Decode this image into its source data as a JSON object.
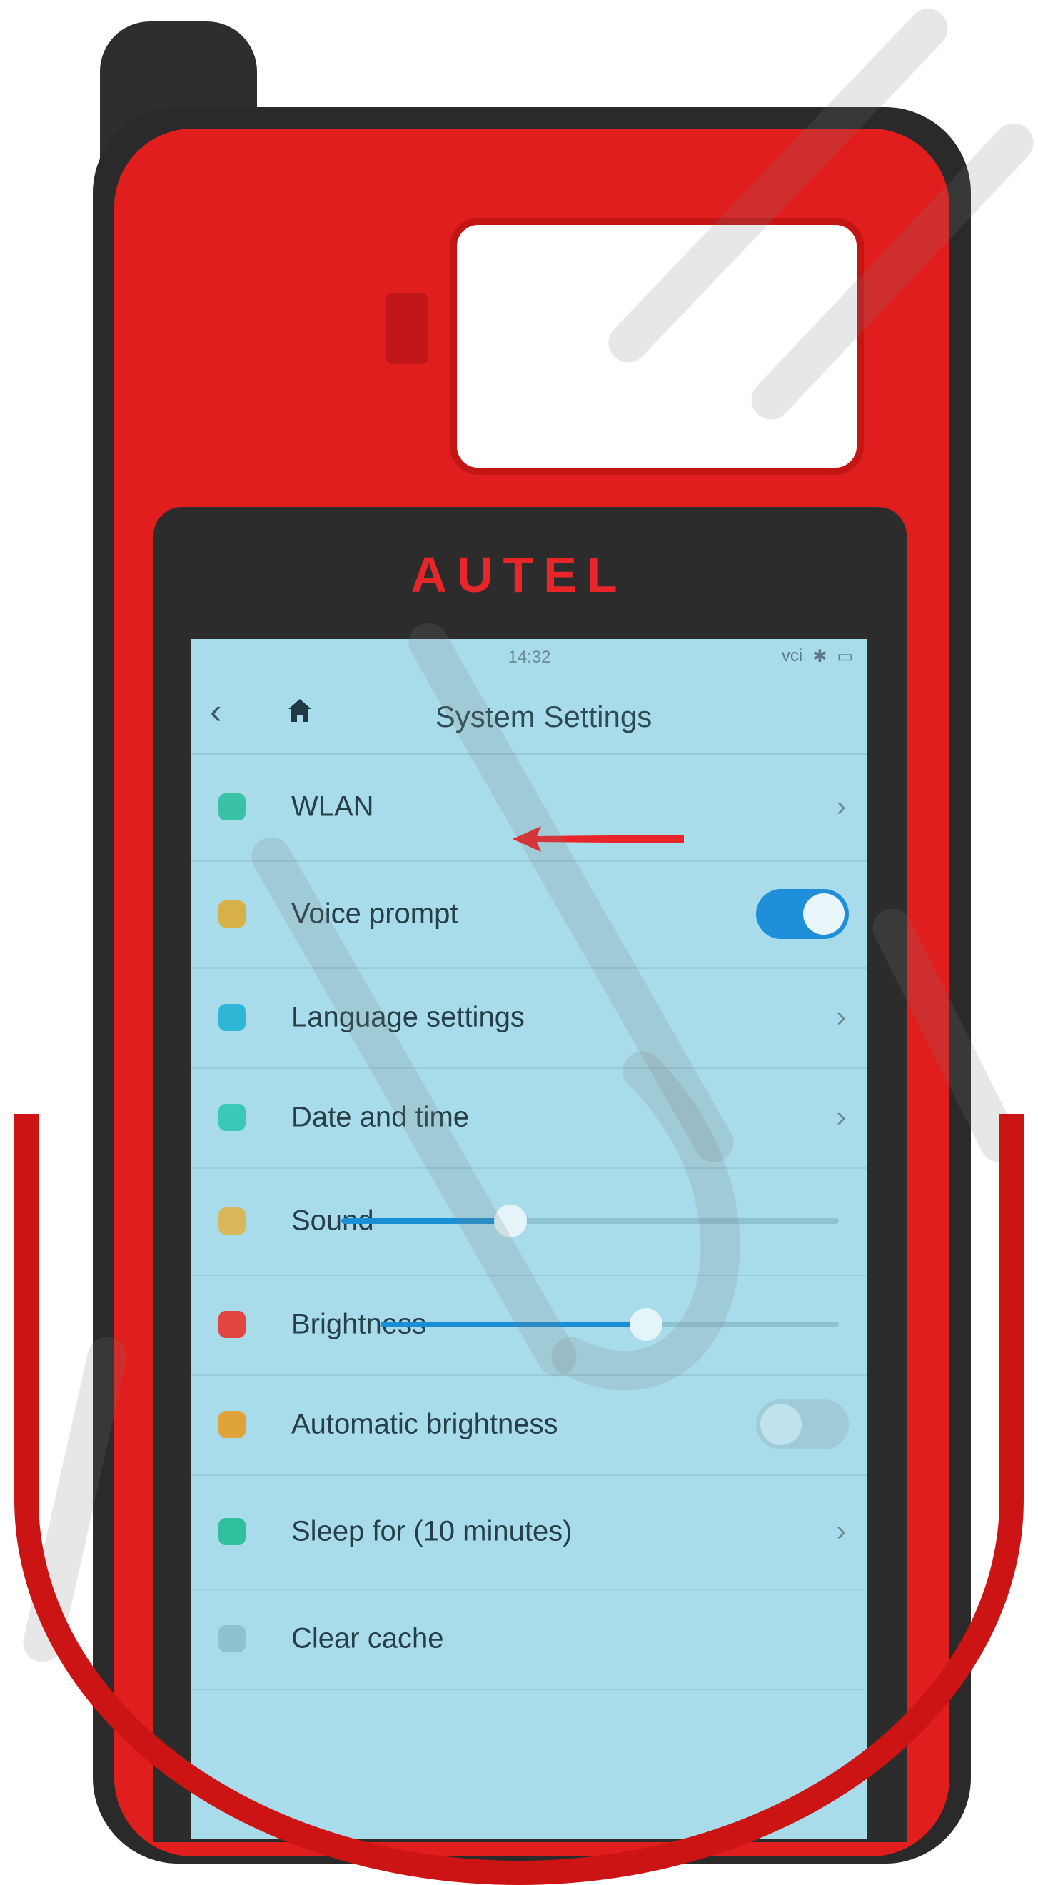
{
  "device": {
    "brand": "AUTEL"
  },
  "status_bar": {
    "time": "14:32",
    "icons": [
      "vci-icon",
      "bluetooth-icon",
      "battery-icon"
    ],
    "icons_text": [
      "vci",
      "✱",
      "▭"
    ]
  },
  "header": {
    "title": "System Settings",
    "back_icon": "‹",
    "home_icon": "home-icon"
  },
  "settings": [
    {
      "label": "WLAN",
      "icon": "wifi-icon",
      "icon_color": "#39c2a6",
      "control": "chevron"
    },
    {
      "label": "Voice prompt",
      "icon": "microphone-icon",
      "icon_color": "#d7b04a",
      "control": "toggle",
      "toggle_on": true
    },
    {
      "label": "Language settings",
      "icon": "language-icon",
      "icon_color": "#2fb6d6",
      "control": "chevron"
    },
    {
      "label": "Date and time",
      "icon": "calendar-icon",
      "icon_color": "#3ac8b8",
      "control": "chevron"
    },
    {
      "label": "Sound",
      "icon": "speaker-icon",
      "icon_color": "#d9b75a",
      "control": "slider",
      "level": 0.34
    },
    {
      "label": "Brightness",
      "icon": "sun-icon",
      "icon_color": "#e0453f",
      "control": "slider",
      "level": 0.58
    },
    {
      "label": "Automatic brightness",
      "icon": "contrast-icon",
      "icon_color": "#e0a23a",
      "control": "toggle",
      "toggle_on": false
    },
    {
      "label": "Sleep for (10 minutes)",
      "icon": "moon-icon",
      "icon_color": "#2fbf9c",
      "control": "chevron"
    },
    {
      "label": "Clear cache",
      "icon": "broom-icon",
      "icon_color": "#8fc2d1",
      "control": "none"
    }
  ],
  "chevron": "›",
  "colors": {
    "shell_red": "#e11e1e",
    "screen_bg": "#a9dceb",
    "accent_blue": "#1a8fd6",
    "arrow_red": "#e8262a"
  }
}
